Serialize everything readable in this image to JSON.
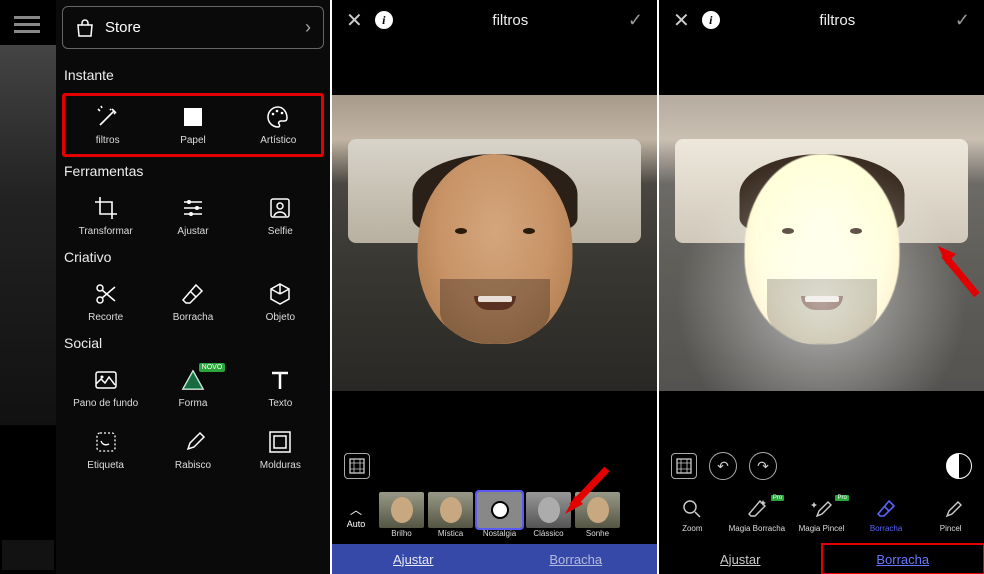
{
  "panel1": {
    "store_label": "Store",
    "sections": {
      "instante": {
        "title": "Instante",
        "items": [
          {
            "label": "filtros"
          },
          {
            "label": "Papel"
          },
          {
            "label": "Artístico"
          }
        ]
      },
      "ferramentas": {
        "title": "Ferramentas",
        "items": [
          {
            "label": "Transformar"
          },
          {
            "label": "Ajustar"
          },
          {
            "label": "Selfie"
          }
        ]
      },
      "criativo": {
        "title": "Criativo",
        "items": [
          {
            "label": "Recorte"
          },
          {
            "label": "Borracha"
          },
          {
            "label": "Objeto"
          }
        ]
      },
      "social": {
        "title": "Social",
        "items": [
          {
            "label": "Pano de fundo"
          },
          {
            "label": "Forma",
            "badge": "NOVO"
          },
          {
            "label": "Texto"
          }
        ]
      },
      "extra": {
        "items": [
          {
            "label": "Etiqueta"
          },
          {
            "label": "Rabisco"
          },
          {
            "label": "Molduras"
          }
        ]
      }
    }
  },
  "panel2": {
    "header_title": "filtros",
    "auto_label": "Auto",
    "filters": [
      {
        "label": "Brilho"
      },
      {
        "label": "Mística"
      },
      {
        "label": "Nostalgia",
        "selected": true
      },
      {
        "label": "Clássico"
      },
      {
        "label": "Sonhe"
      }
    ],
    "tabs": {
      "left": "Ajustar",
      "right": "Borracha"
    }
  },
  "panel3": {
    "header_title": "filtros",
    "tools": [
      {
        "label": "Zoom"
      },
      {
        "label": "Magia Borracha",
        "pro": "Pro"
      },
      {
        "label": "Magia Pincel",
        "pro": "Pro"
      },
      {
        "label": "Borracha",
        "selected": true
      },
      {
        "label": "Pincel"
      }
    ],
    "tabs": {
      "left": "Ajustar",
      "right": "Borracha"
    }
  }
}
